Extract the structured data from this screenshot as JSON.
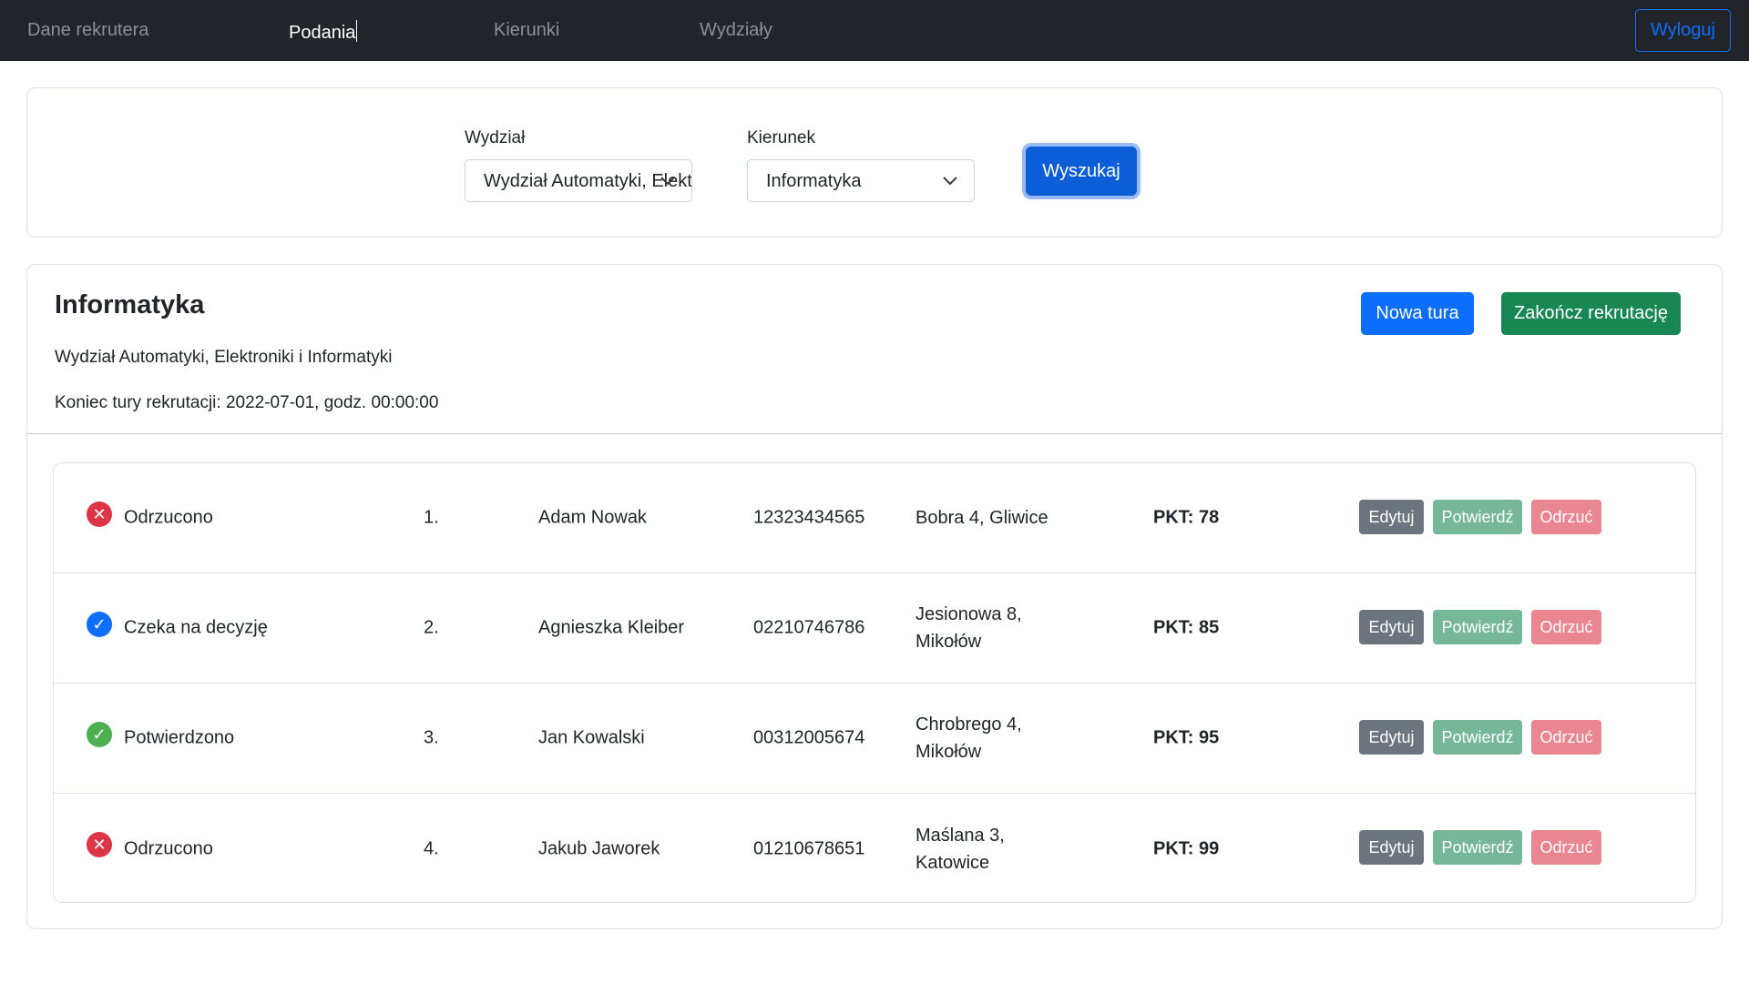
{
  "nav": {
    "items": [
      {
        "label": "Dane rekrutera",
        "active": false
      },
      {
        "label": "Podania",
        "active": true
      },
      {
        "label": "Kierunki",
        "active": false
      },
      {
        "label": "Wydziały",
        "active": false
      }
    ],
    "logout_label": "Wyloguj"
  },
  "search": {
    "faculty_label": "Wydział",
    "faculty_value": "Wydział Automatyki, Elektroniki i Informatyki",
    "major_label": "Kierunek",
    "major_value": "Informatyka",
    "search_label": "Wyszukaj"
  },
  "main": {
    "title": "Informatyka",
    "faculty": "Wydział Automatyki, Elektroniki i Informatyki",
    "round_end": "Koniec tury rekrutacji: 2022-07-01, godz. 00:00:00",
    "new_round_label": "Nowa tura",
    "finish_label": "Zakończ rekrutację"
  },
  "actions": {
    "edit": "Edytuj",
    "confirm": "Potwierdź",
    "reject": "Odrzuć"
  },
  "applications": [
    {
      "status": "Odrzucono",
      "status_icon": "x-circle-icon",
      "status_color": "#dc3545",
      "number": "1.",
      "name": "Adam Nowak",
      "pesel": "12323434565",
      "address_line1": "Bobra 4, Gliwice",
      "address_line2": "",
      "points": "PKT: 78"
    },
    {
      "status": "Czeka na decyzję",
      "status_icon": "check-circle-icon",
      "status_color": "#0d6efd",
      "number": "2.",
      "name": "Agnieszka Kleiber",
      "pesel": "02210746786",
      "address_line1": "Jesionowa 8,",
      "address_line2": "Mikołów",
      "points": "PKT: 85"
    },
    {
      "status": "Potwierdzono",
      "status_icon": "check-circle-icon",
      "status_color": "#4caf50",
      "number": "3.",
      "name": "Jan Kowalski",
      "pesel": "00312005674",
      "address_line1": "Chrobrego 4,",
      "address_line2": "Mikołów",
      "points": "PKT: 95"
    },
    {
      "status": "Odrzucono",
      "status_icon": "x-circle-icon",
      "status_color": "#dc3545",
      "number": "4.",
      "name": "Jakub Jaworek",
      "pesel": "01210678651",
      "address_line1": "Maślana 3,",
      "address_line2": "Katowice",
      "points": "PKT: 99"
    }
  ],
  "colors": {
    "navbar": "#212529",
    "primary": "#0d6efd",
    "success": "#198754",
    "edit": "#6c757d",
    "confirm": "#75b798",
    "reject": "#ea868f"
  }
}
